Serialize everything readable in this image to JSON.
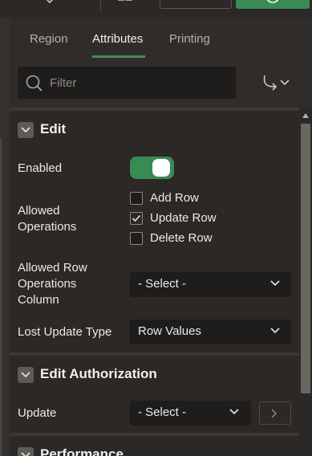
{
  "tabs": [
    {
      "label": "Region"
    },
    {
      "label": "Attributes"
    },
    {
      "label": "Printing"
    }
  ],
  "filter": {
    "placeholder": "Filter"
  },
  "sections": {
    "edit": {
      "title": "Edit",
      "enabled_label": "Enabled",
      "enabled": true,
      "allowed_operations_label": "Allowed Operations",
      "operations": [
        {
          "label": "Add Row",
          "checked": false
        },
        {
          "label": "Update Row",
          "checked": true
        },
        {
          "label": "Delete Row",
          "checked": false
        }
      ],
      "allowed_row_ops_col_label": "Allowed Row Operations Column",
      "allowed_row_ops_col_value": "- Select -",
      "lost_update_label": "Lost Update Type",
      "lost_update_value": "Row Values"
    },
    "edit_authorization": {
      "title": "Edit Authorization",
      "update_label": "Update",
      "update_value": "- Select -"
    },
    "performance": {
      "title": "Performance"
    }
  },
  "colors": {
    "accent_green": "#3a8a55",
    "background": "#2b2826",
    "field_background": "#1f1d1c"
  }
}
